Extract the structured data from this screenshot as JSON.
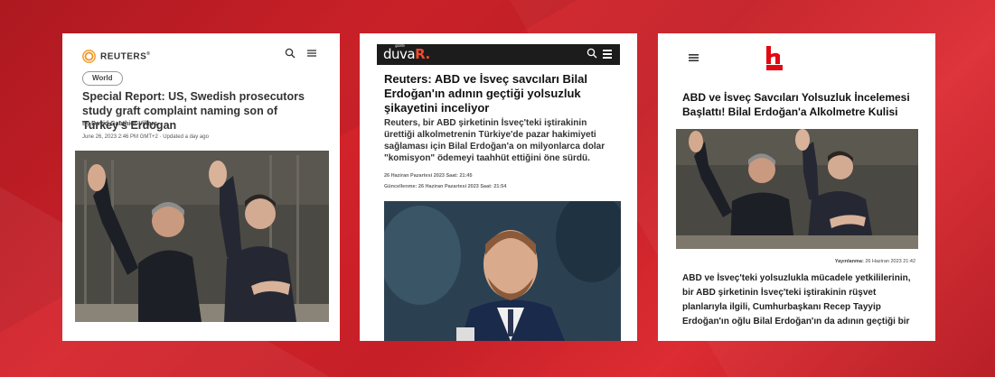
{
  "cards": {
    "reuters": {
      "brand": "REUTERS",
      "brand_mark": "®",
      "tag": "World",
      "headline": "Special Report: US, Swedish prosecutors study graft complaint naming son of Turkey's Erdogan",
      "byline_prefix": "By",
      "author": "David Gauthier-Villars",
      "dateline": "June 26, 2023 2:46 PM GMT+2 · Updated a day ago",
      "icons": [
        "search-icon",
        "menu-icon"
      ]
    },
    "duvar": {
      "logo_main": "duva",
      "logo_accent": "R.",
      "logo_small": "gazete",
      "headline": "Reuters: ABD ve İsveç savcıları Bilal Erdoğan'ın adının geçtiği yolsuzluk şikayetini inceliyor",
      "summary": "Reuters, bir ABD şirketinin İsveç'teki iştirakinin ürettiği alkolmetrenin Türkiye'de pazar hakimiyeti sağlaması için Bilal Erdoğan'a on milyonlarca dolar \"komisyon\" ödemeyi taahhüt ettiğini öne sürdü.",
      "published": "26 Haziran Pazartesi 2023   Saat: 21:45",
      "updated": "Güncellenme: 26 Haziran Pazartesi 2023   Saat: 21:54",
      "icons": [
        "search-icon",
        "menu-icon"
      ]
    },
    "halktv": {
      "logo_text": "halk",
      "headline": "ABD ve İsveç Savcıları Yolsuzluk İncelemesi Başlattı! Bilal Erdoğan'a Alkolmetre Kulisi",
      "pub_label": "Yayınlanma:",
      "pub_date": "26 Haziran 2023 21:42",
      "body": "ABD ve İsveç'teki yolsuzlukla mücadele yetkililerinin, bir ABD şirketinin İsveç'teki iştirakinin rüşvet planlarıyla ilgili, Cumhurbaşkanı Recep Tayyip Erdoğan'ın oğlu Bilal Erdoğan'ın da adının geçtiği bir",
      "icons": [
        "menu-icon"
      ]
    }
  },
  "colors": {
    "background_red": "#d6232b",
    "reuters_orange": "#f39321",
    "duvar_accent": "#f04b2d",
    "halk_red": "#e30613"
  }
}
